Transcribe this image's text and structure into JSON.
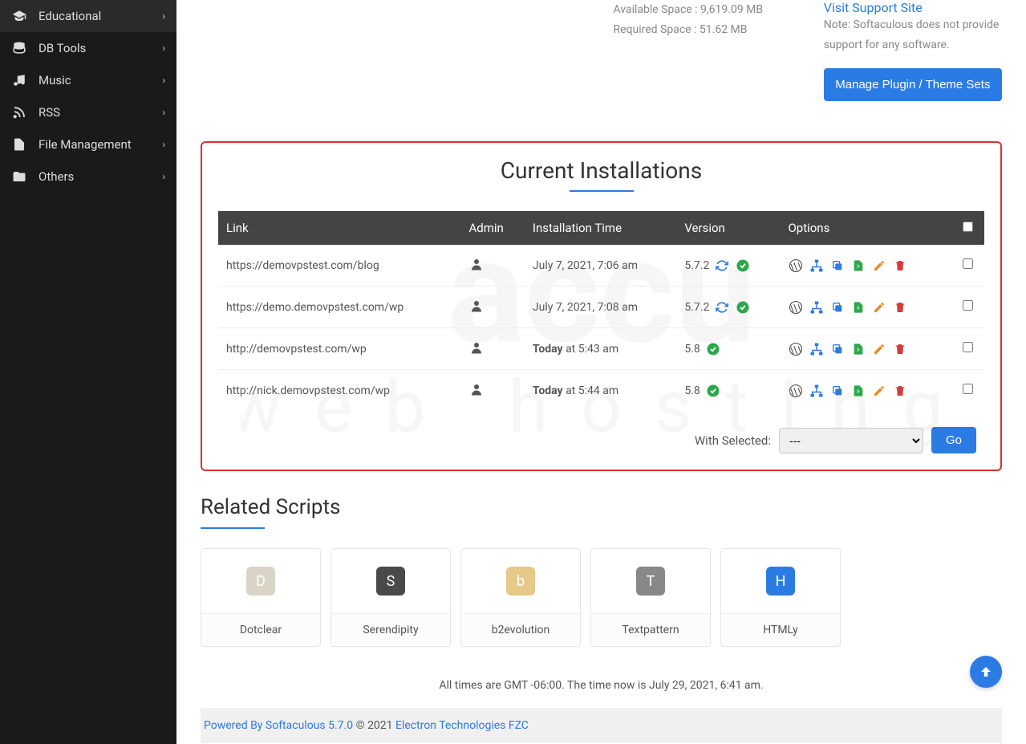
{
  "sidebar": {
    "items": [
      {
        "label": "Educational",
        "icon": "graduation-cap-icon"
      },
      {
        "label": "DB Tools",
        "icon": "database-icon"
      },
      {
        "label": "Music",
        "icon": "music-icon"
      },
      {
        "label": "RSS",
        "icon": "rss-icon"
      },
      {
        "label": "File Management",
        "icon": "files-icon"
      },
      {
        "label": "Others",
        "icon": "folder-open-icon"
      }
    ]
  },
  "info": {
    "available_space": "Available Space : 9,619.09 MB",
    "required_space": "Required Space : 51.62 MB",
    "visit_support": "Visit Support Site",
    "support_note": "Note: Softaculous does not provide support for any software.",
    "manage_btn": "Manage Plugin / Theme Sets"
  },
  "installs": {
    "heading": "Current Installations",
    "columns": {
      "link": "Link",
      "admin": "Admin",
      "time": "Installation Time",
      "version": "Version",
      "options": "Options"
    },
    "rows": [
      {
        "link": "https://demovpstest.com/blog",
        "time_prefix": "",
        "time": "July 7, 2021, 7:06 am",
        "version": "5.7.2",
        "needs_update": true
      },
      {
        "link": "https://demo.demovpstest.com/wp",
        "time_prefix": "",
        "time": "July 7, 2021, 7:08 am",
        "version": "5.7.2",
        "needs_update": true
      },
      {
        "link": "http://demovpstest.com/wp",
        "time_prefix": "Today",
        "time": " at 5:43 am",
        "version": "5.8",
        "needs_update": false
      },
      {
        "link": "http://nick.demovpstest.com/wp",
        "time_prefix": "Today",
        "time": " at 5:44 am",
        "version": "5.8",
        "needs_update": false
      }
    ],
    "bulk_label": "With Selected:",
    "bulk_default": "---",
    "go": "Go"
  },
  "related": {
    "heading": "Related Scripts",
    "scripts": [
      {
        "name": "Dotclear"
      },
      {
        "name": "Serendipity"
      },
      {
        "name": "b2evolution"
      },
      {
        "name": "Textpattern"
      },
      {
        "name": "HTMLy"
      }
    ]
  },
  "footer": {
    "time_note": "All times are GMT -06:00. The time now is July 29, 2021, 6:41 am.",
    "powered": "Powered By Softaculous 5.7.0",
    "copyright": " © 2021 ",
    "company": "Electron Technologies FZC"
  }
}
